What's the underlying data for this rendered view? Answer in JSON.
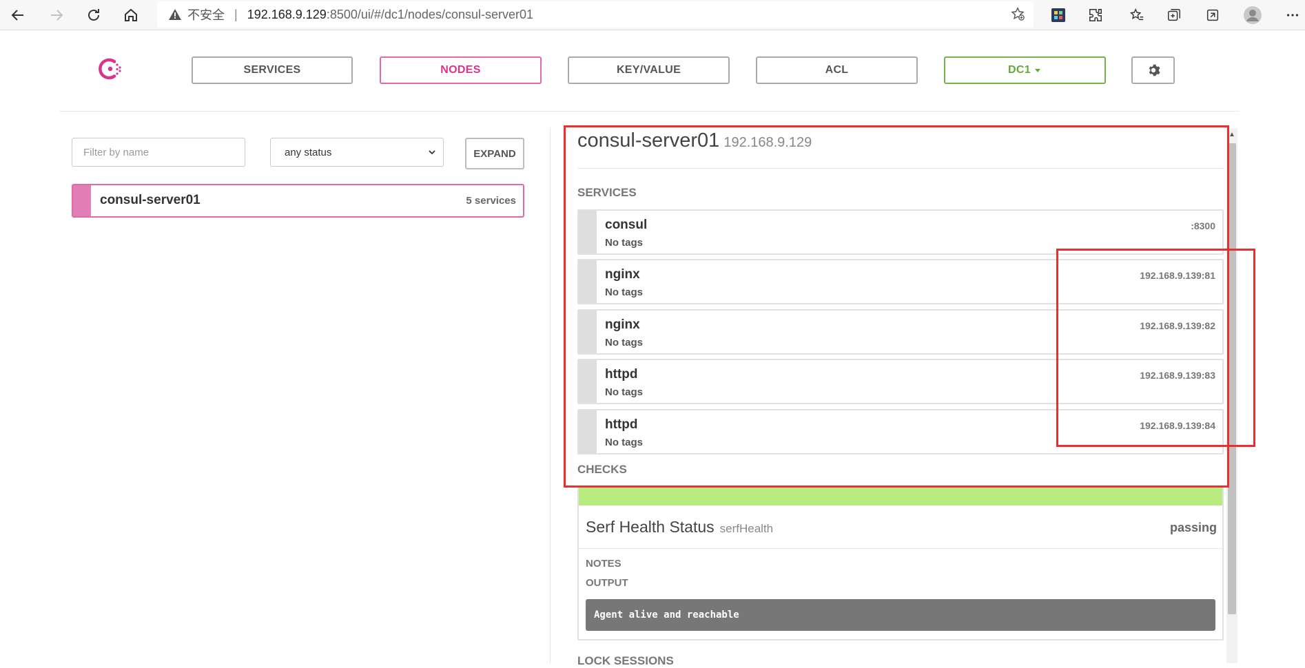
{
  "browser": {
    "insecure_label": "不安全",
    "separator": "|",
    "url_host": "192.168.9.129",
    "url_rest": ":8500/ui/#/dc1/nodes/consul-server01"
  },
  "nav": {
    "services": "SERVICES",
    "nodes": "NODES",
    "keyvalue": "KEY/VALUE",
    "acl": "ACL",
    "datacenter": "DC1",
    "active": "NODES"
  },
  "filter": {
    "placeholder": "Filter by name",
    "status_value": "any status",
    "expand_label": "EXPAND"
  },
  "node_list": [
    {
      "name": "consul-server01",
      "count": "5 services"
    }
  ],
  "detail": {
    "node_name": "consul-server01",
    "node_ip": "192.168.9.129",
    "services_label": "SERVICES",
    "services": [
      {
        "name": "consul",
        "tags": "No tags",
        "address": ":8300"
      },
      {
        "name": "nginx",
        "tags": "No tags",
        "address": "192.168.9.139:81"
      },
      {
        "name": "nginx",
        "tags": "No tags",
        "address": "192.168.9.139:82"
      },
      {
        "name": "httpd",
        "tags": "No tags",
        "address": "192.168.9.139:83"
      },
      {
        "name": "httpd",
        "tags": "No tags",
        "address": "192.168.9.139:84"
      }
    ],
    "checks_label": "CHECKS",
    "check": {
      "name": "Serf Health Status",
      "id": "serfHealth",
      "status": "passing",
      "notes_label": "NOTES",
      "output_label": "OUTPUT",
      "output": "Agent alive and reachable"
    },
    "lock_sessions_label": "LOCK SESSIONS"
  },
  "colors": {
    "accent_pink": "#d9348b",
    "passing_green": "#b8ec80",
    "dc_green": "#65a93b",
    "annotation_red": "#e8302e"
  }
}
